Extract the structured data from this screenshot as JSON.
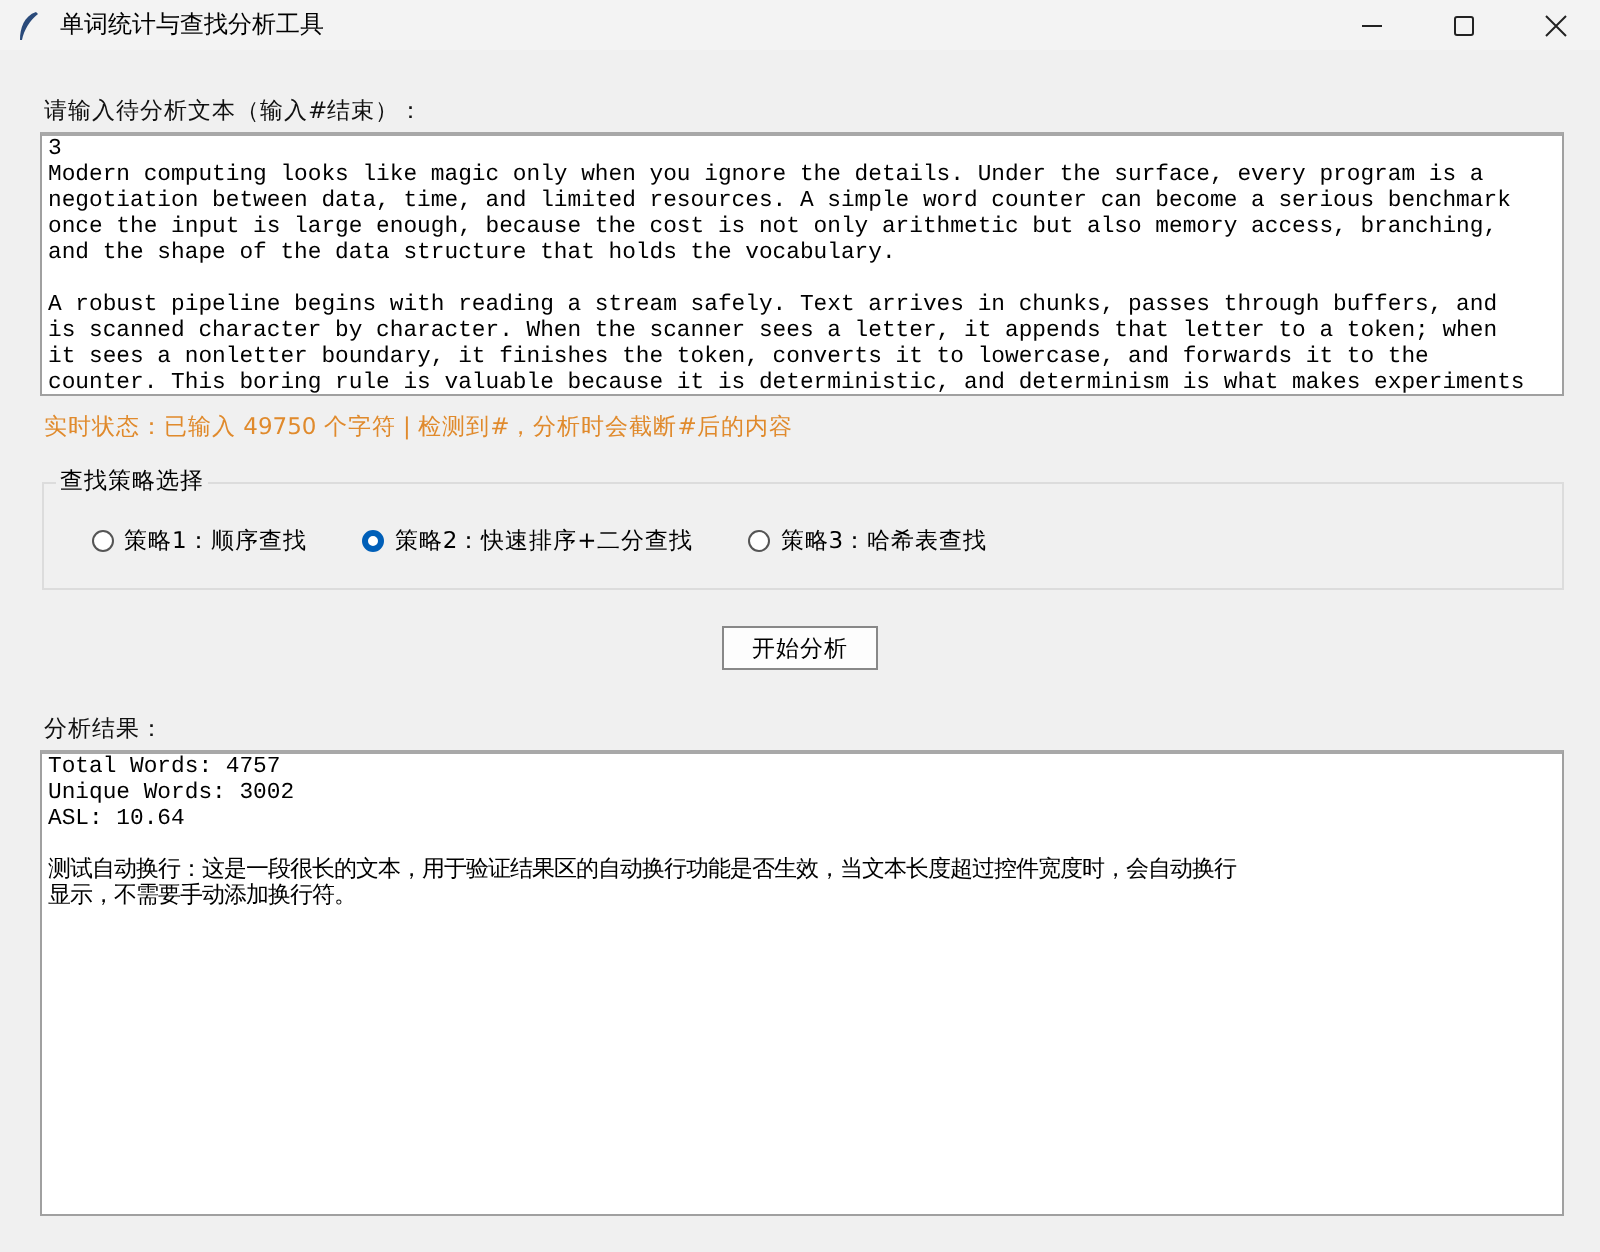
{
  "window": {
    "title": "单词统计与查找分析工具"
  },
  "input": {
    "label": "请输入待分析文本（输入#结束）：",
    "paragraphs": [
      [
        "3",
        "Modern computing looks like magic only when you ignore the details. Under the surface, every program is a",
        "negotiation between data, time, and limited resources. A simple word counter can become a serious benchmark",
        "once the input is large enough, because the cost is not only arithmetic but also memory access, branching,",
        "and the shape of the data structure that holds the vocabulary."
      ],
      [
        "A robust pipeline begins with reading a stream safely. Text arrives in chunks, passes through buffers, and",
        "is scanned character by character. When the scanner sees a letter, it appends that letter to a token; when",
        "it sees a nonletter boundary, it finishes the token, converts it to lowercase, and forwards it to the",
        "counter. This boring rule is valuable because it is deterministic, and determinism is what makes experiments"
      ]
    ]
  },
  "status": "实时状态：已输入 49750 个字符 | 检测到#，分析时会截断#后的内容",
  "strategy": {
    "title": "查找策略选择",
    "options": [
      {
        "label": "策略1：顺序查找",
        "selected": false
      },
      {
        "label": "策略2：快速排序+二分查找",
        "selected": true
      },
      {
        "label": "策略3：哈希表查找",
        "selected": false
      }
    ]
  },
  "start_button": "开始分析",
  "results": {
    "label": "分析结果：",
    "paragraphs": [
      [
        "Total Words: 4757",
        "Unique Words: 3002",
        "ASL: 10.64"
      ],
      [
        "测试自动换行：这是一段很长的文本，用于验证结果区的自动换行功能是否生效，当文本长度超过控件宽度时，会自动换行",
        "显示，不需要手动添加换行符。"
      ]
    ]
  }
}
